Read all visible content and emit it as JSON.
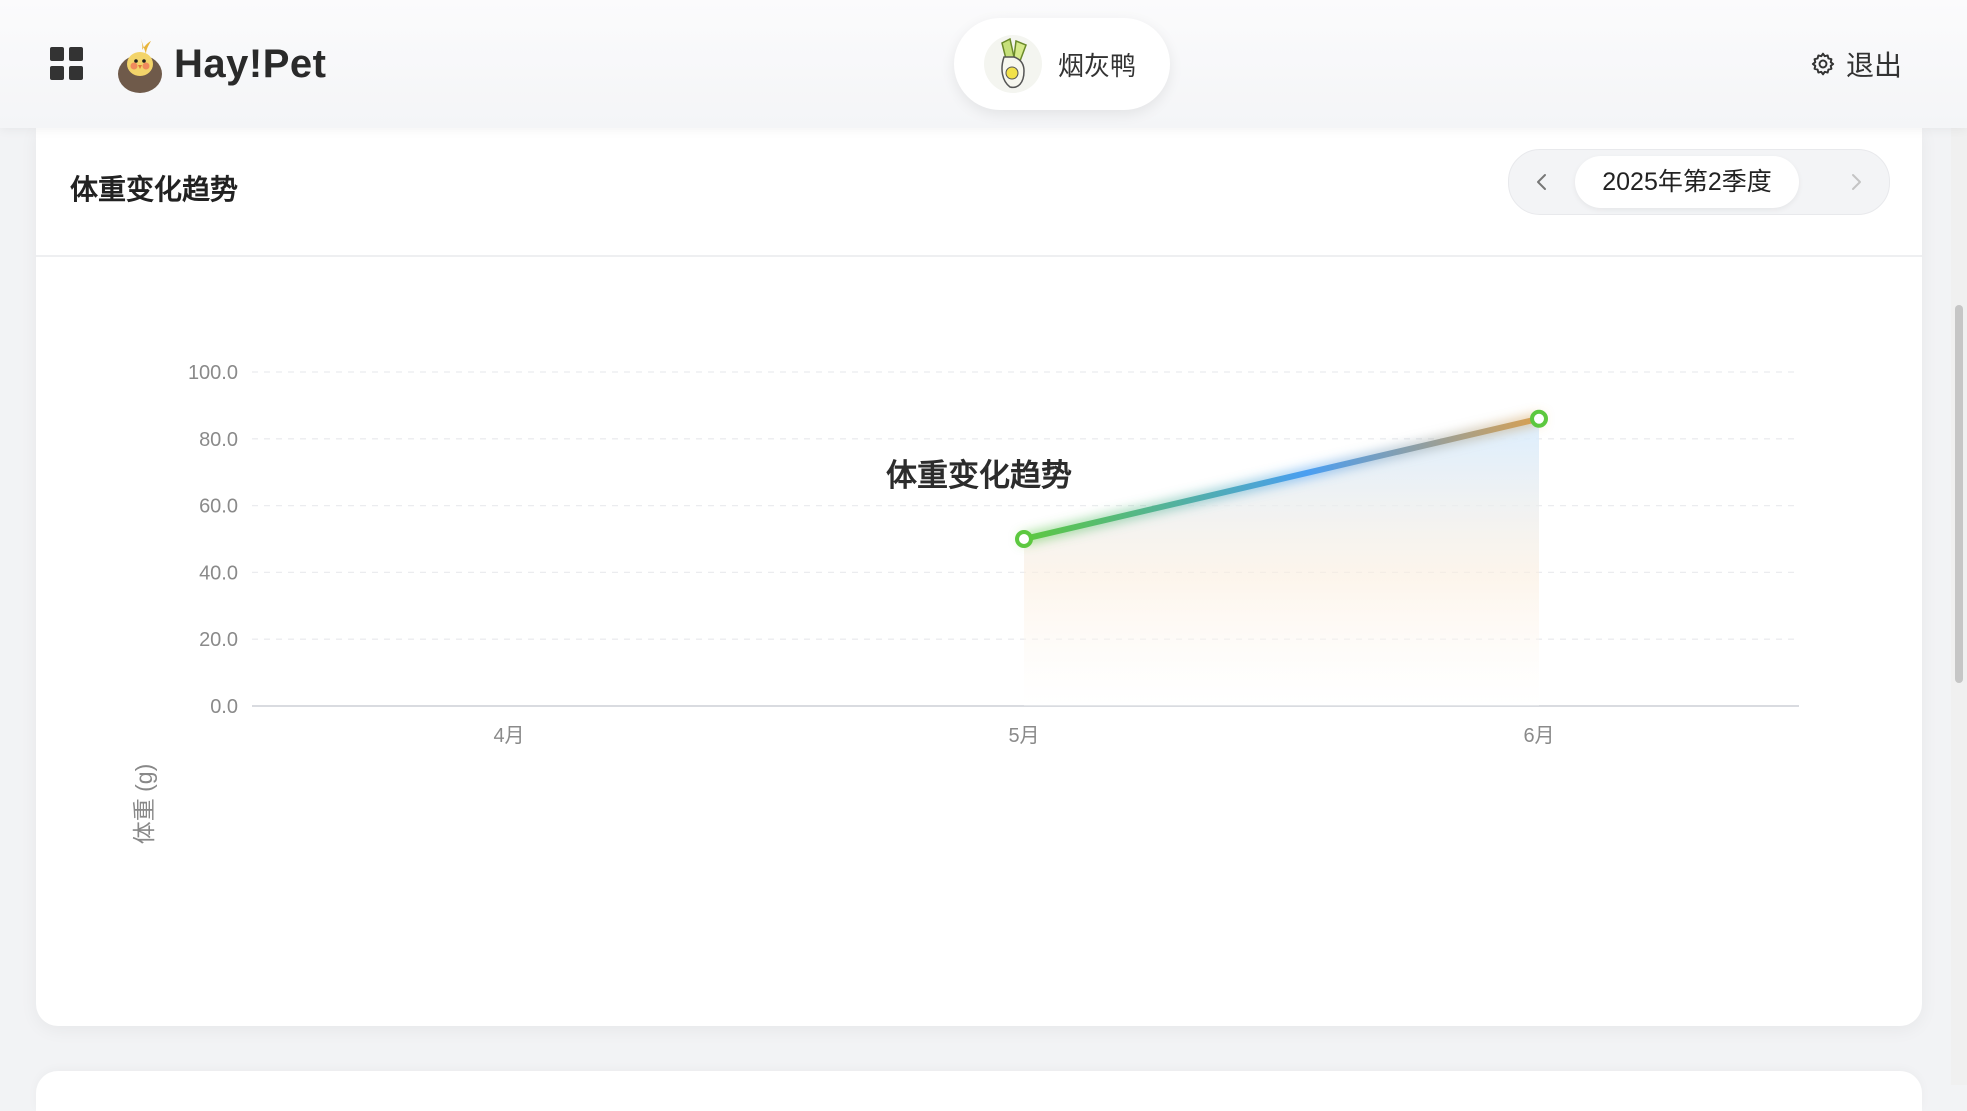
{
  "header": {
    "app_name": "Hay!Pet",
    "menu_icon": "grid-icon",
    "logo_icon": "cockatiel-logo-icon",
    "pet": {
      "name": "烟灰鸭",
      "avatar_icon": "pet-avatar-icon"
    },
    "logout": {
      "label": "退出",
      "icon": "gear-icon"
    }
  },
  "card": {
    "title": "体重变化趋势",
    "period": {
      "label": "2025年第2季度",
      "prev_icon": "chevron-left-icon",
      "next_icon": "chevron-right-icon"
    }
  },
  "chart_data": {
    "type": "line",
    "title": "体重变化趋势",
    "xlabel": "",
    "ylabel": "体重 (g)",
    "categories": [
      "4月",
      "5月",
      "6月"
    ],
    "series": [
      {
        "values": [
          null,
          50,
          86
        ]
      }
    ],
    "ylim": [
      0,
      100
    ],
    "yticks": [
      "0.0",
      "20.0",
      "40.0",
      "60.0",
      "80.0",
      "100.0"
    ],
    "grid": true,
    "legend": "none",
    "colors": {
      "line_start": "#5cc83f",
      "line_mid": "#4a9ef2",
      "line_end": "#d9a050",
      "point": "#5cc83f"
    }
  }
}
